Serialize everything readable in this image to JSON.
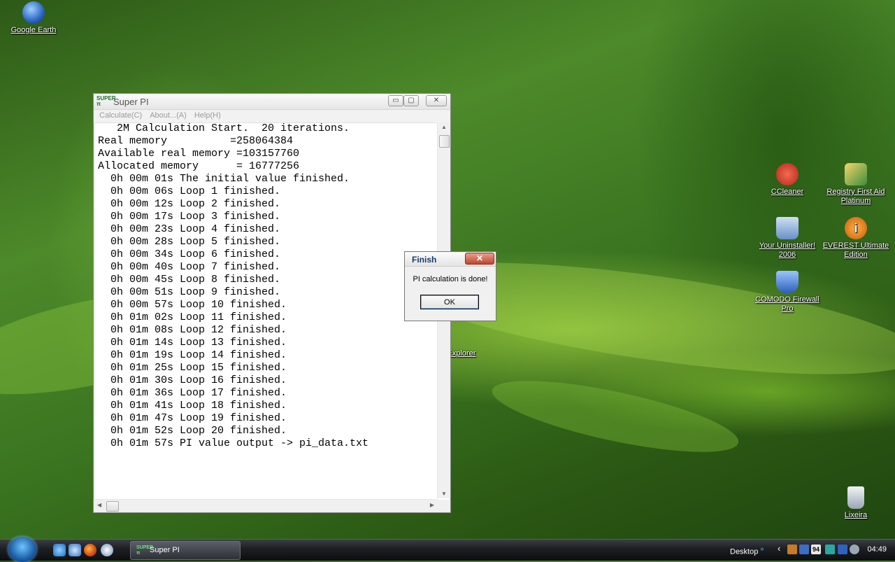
{
  "desktop": {
    "icons": [
      {
        "label": "Google Earth",
        "color": "#2b64c0"
      },
      {
        "label": "CCleaner",
        "color": "#d43b2a"
      },
      {
        "label": "Registry First Aid Platinum",
        "color": "#e8b84a"
      },
      {
        "label": "Your Uninstaller! 2006",
        "color": "#6a8fc7"
      },
      {
        "label": "EVEREST Ultimate Edition",
        "color": "#e07b10"
      },
      {
        "label": "COMODO Firewall Pro",
        "color": "#3f78c8"
      },
      {
        "label": "Explorer",
        "color": "#c58a2c"
      },
      {
        "label": "Lixeira",
        "color": "#c9d2da"
      }
    ]
  },
  "window": {
    "title": "Super PI",
    "app_icon_text": "SUPER\nπ",
    "controls": {
      "minimize": "▭",
      "maximize": "▢",
      "close": "✕"
    },
    "menu": [
      "Calculate(C)",
      "About...(A)",
      "Help(H)"
    ],
    "lines": [
      "   2M Calculation Start.  20 iterations.",
      "Real memory          =258064384",
      "Available real memory =103157760",
      "Allocated memory      = 16777256",
      "  0h 00m 01s The initial value finished.",
      "  0h 00m 06s Loop 1 finished.",
      "  0h 00m 12s Loop 2 finished.",
      "  0h 00m 17s Loop 3 finished.",
      "  0h 00m 23s Loop 4 finished.",
      "  0h 00m 28s Loop 5 finished.",
      "  0h 00m 34s Loop 6 finished.",
      "  0h 00m 40s Loop 7 finished.",
      "  0h 00m 45s Loop 8 finished.",
      "  0h 00m 51s Loop 9 finished.",
      "  0h 00m 57s Loop 10 finished.",
      "  0h 01m 02s Loop 11 finished.",
      "  0h 01m 08s Loop 12 finished.",
      "  0h 01m 14s Loop 13 finished.",
      "  0h 01m 19s Loop 14 finished.",
      "  0h 01m 25s Loop 15 finished.",
      "  0h 01m 30s Loop 16 finished.",
      "  0h 01m 36s Loop 17 finished.",
      "  0h 01m 41s Loop 18 finished.",
      "  0h 01m 47s Loop 19 finished.",
      "  0h 01m 52s Loop 20 finished.",
      "  0h 01m 57s PI value output -> pi_data.txt"
    ]
  },
  "dialog": {
    "title": "Finish",
    "close": "✕",
    "message": "PI calculation is done!",
    "ok": "OK"
  },
  "taskbar": {
    "app_label": "Super PI",
    "app_icon_text": "SUPER\nπ",
    "desktop_label": "Desktop",
    "desktop_chevron": "»",
    "tray_chevron": "‹",
    "tray_badge": "94",
    "clock": "04:49"
  }
}
